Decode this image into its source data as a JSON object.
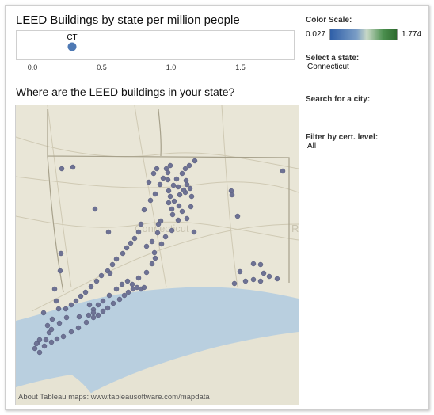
{
  "dashboard": {
    "top_title": "LEED Buildings by state per million people",
    "map_title": "Where are the LEED buildings in your state?",
    "map_credit": "About Tableau maps: www.tableausoftware.com/mapdata",
    "map_state_label": "Connecticut",
    "map_edge_label": "R"
  },
  "chart_data": {
    "type": "scatter",
    "points": [
      {
        "label": "CT",
        "x": 0.28
      }
    ],
    "x_ticks": [
      "0.0",
      "0.5",
      "1.0",
      "1.5"
    ],
    "xlim": [
      -0.12,
      1.88
    ],
    "point_color": "#4e79b4"
  },
  "sidebar": {
    "color_scale": {
      "label": "Color Scale:",
      "min": "0.027",
      "max": "1.774",
      "marker_fraction": 0.15
    },
    "state": {
      "label": "Select a state:",
      "value": "Connecticut"
    },
    "city": {
      "label": "Search for a city:"
    },
    "cert": {
      "label": "Filter by cert. level:",
      "value": "All"
    }
  },
  "colors": {
    "map_land": "#e9e6d7",
    "map_water": "#b9cfdf",
    "map_point": "#6e7294"
  }
}
